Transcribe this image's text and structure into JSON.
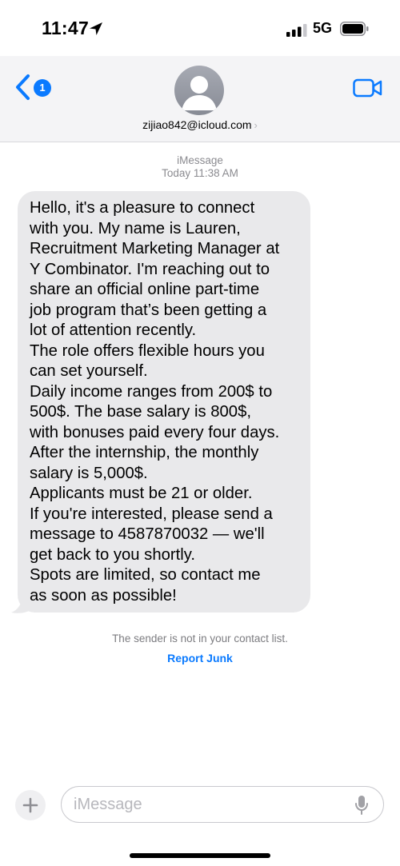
{
  "status_bar": {
    "time": "11:47",
    "network": "5G",
    "icons": [
      "location-arrow-icon",
      "signal-bars-icon",
      "battery-icon"
    ]
  },
  "header": {
    "back_badge_count": "1",
    "contact": "zijiao842@icloud.com",
    "icons": [
      "back-chevron-icon",
      "avatar-person-icon",
      "video-camera-icon",
      "chevron-right-icon"
    ]
  },
  "thread": {
    "service": "iMessage",
    "timestamp_day": "Today",
    "timestamp_time": "11:38 AM",
    "message_lines": [
      "Hello, it's a pleasure to connect",
      "with you. My name is Lauren,",
      "Recruitment Marketing Manager at",
      "Y Combinator. I'm reaching out to",
      "share an official online part-time",
      "job program that’s been getting a",
      "lot of attention recently.",
      "The role offers flexible hours you",
      "can set yourself.",
      "Daily income ranges from 200$ to",
      "500$. The base salary is 800$,",
      "with bonuses paid every four days.",
      "After the internship, the monthly",
      "salary is 5,000$.",
      "Applicants must be 21 or older.",
      "If you're interested, please send a",
      "message to 4587870032 — we'll",
      "get back to you shortly.",
      "Spots are limited, so contact me",
      "as soon as possible!"
    ],
    "notice": "The sender is not in your contact list.",
    "report_label": "Report Junk"
  },
  "compose": {
    "placeholder": "iMessage",
    "icons": [
      "plus-icon",
      "microphone-icon"
    ]
  },
  "colors": {
    "accent_blue": "#0a7aff",
    "bubble_gray": "#e9e9eb",
    "header_bg": "#f4f4f6",
    "secondary_text": "#8b8b90"
  }
}
